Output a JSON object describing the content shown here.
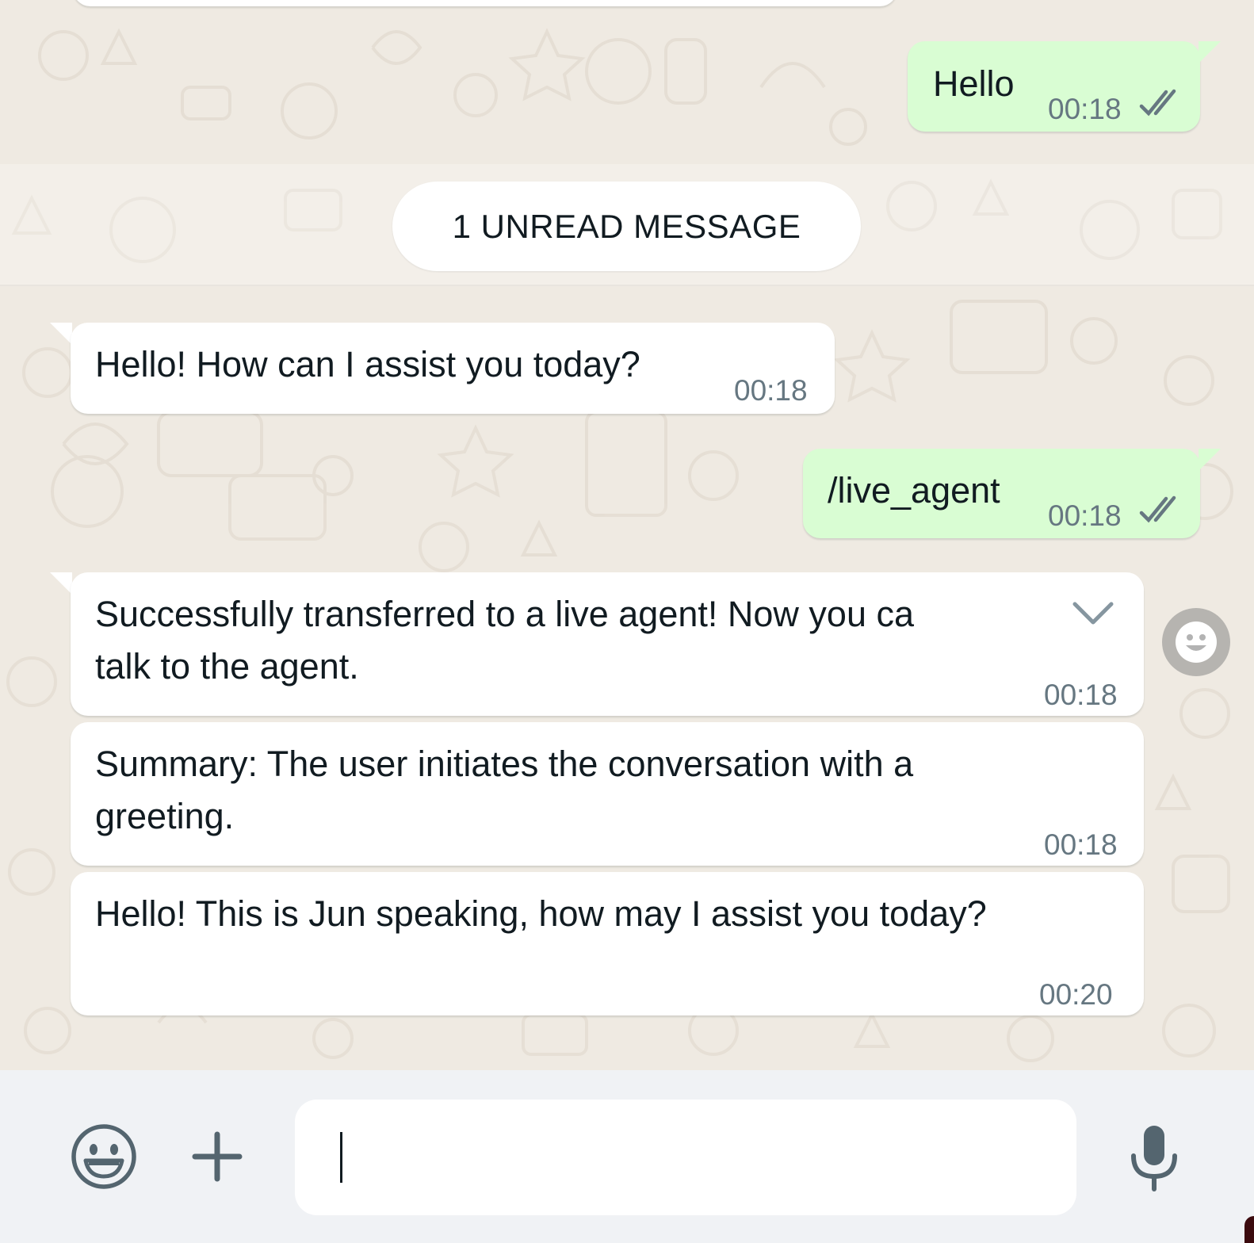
{
  "conversation": {
    "unread_divider": "1 UNREAD MESSAGE",
    "messages": [
      {
        "direction": "outgoing",
        "text": "Hello",
        "time": "00:18",
        "status_icon": "double-check-icon"
      },
      {
        "direction": "incoming",
        "text": "Hello! How can I assist you today?",
        "time": "00:18"
      },
      {
        "direction": "outgoing",
        "text": "/live_agent",
        "time": "00:18",
        "status_icon": "double-check-icon"
      },
      {
        "direction": "incoming",
        "text": "Successfully transferred to a live agent! Now you ca",
        "text_cont": "talk to the agent.",
        "time": "00:18",
        "menu_icon": "chevron-down-icon"
      },
      {
        "direction": "incoming",
        "text": "Summary: The user initiates the conversation with a",
        "text_cont": "greeting.",
        "time": "00:18"
      },
      {
        "direction": "incoming",
        "text": "Hello! This is Jun speaking, how may I assist you today?",
        "time": "00:20"
      }
    ]
  },
  "composer": {
    "emoji_icon": "smiley-icon",
    "attach_icon": "plus-icon",
    "input_value": "",
    "mic_icon": "microphone-icon"
  },
  "colors": {
    "chat_background": "#efeae2",
    "outgoing_bubble": "#d9fdd3",
    "incoming_bubble": "#ffffff",
    "timestamp": "#667781",
    "composer_background": "#f0f2f5",
    "icon": "#54656f"
  }
}
